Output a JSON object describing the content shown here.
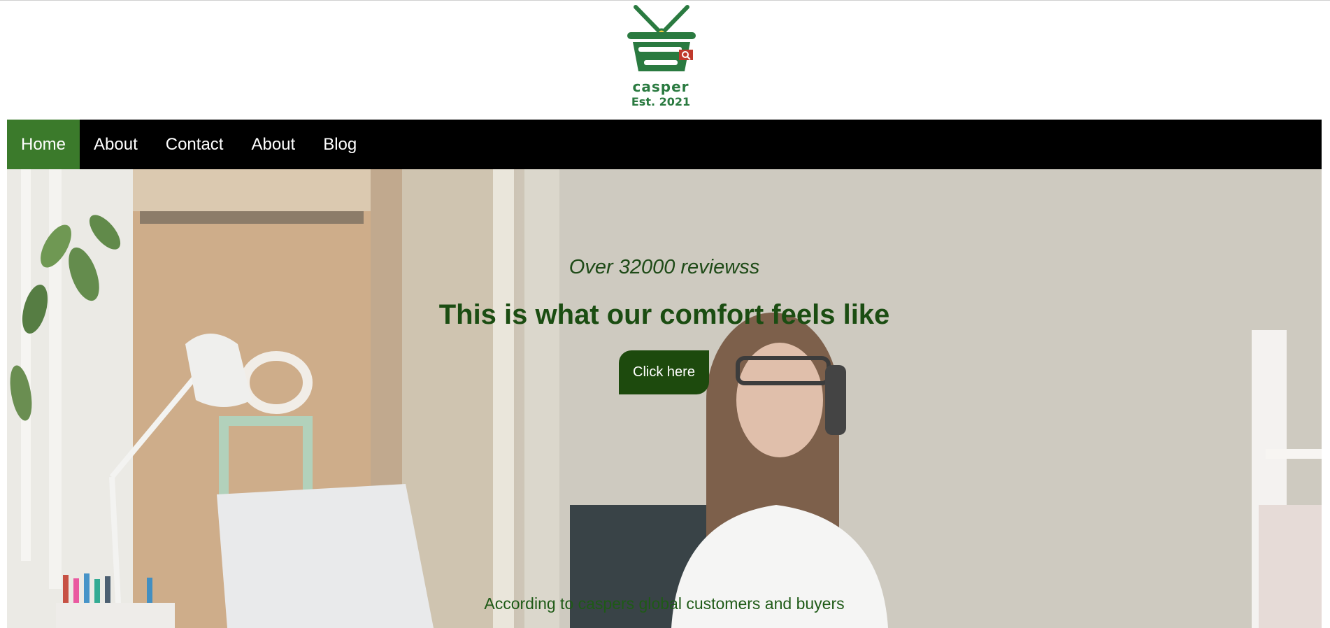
{
  "brand": {
    "name": "casper",
    "established": "Est. 2021",
    "logo_icon": "shopping-basket-icon",
    "colors": {
      "green": "#2a7a40",
      "accent_red": "#c0392b",
      "accent_yellow": "#f4d03f"
    }
  },
  "nav": {
    "items": [
      {
        "label": "Home",
        "active": true
      },
      {
        "label": "About",
        "active": false
      },
      {
        "label": "Contact",
        "active": false
      },
      {
        "label": "About",
        "active": false
      },
      {
        "label": "Blog",
        "active": false
      }
    ],
    "colors": {
      "background": "#000000",
      "active": "#3b7a2b",
      "text": "#ffffff"
    }
  },
  "hero": {
    "reviews_text": "Over 32000 reviewss",
    "headline": "This is what our comfort feels like",
    "cta_label": "Click here",
    "caption": "According to caspers global customers and buyers",
    "colors": {
      "heading": "#1b4d12",
      "button": "#1d4a0d"
    }
  }
}
